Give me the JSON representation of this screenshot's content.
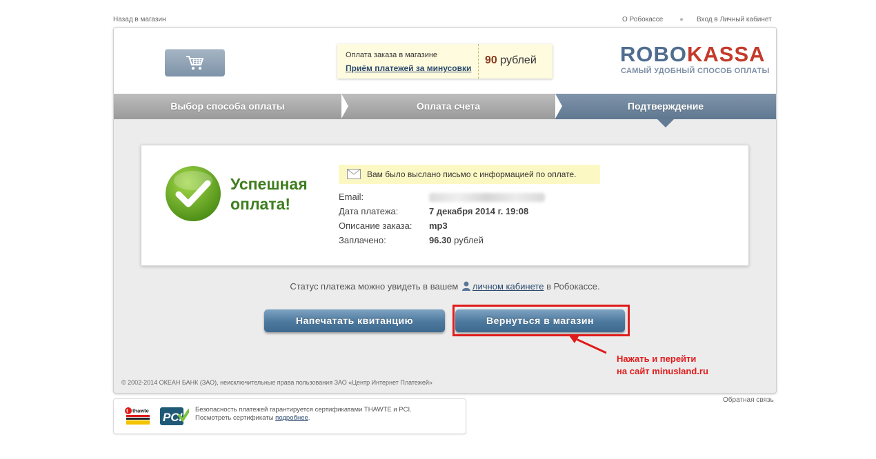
{
  "toplinks": {
    "back_to_shop": "Назад в магазин",
    "about": "О Робокассе",
    "login": "Вход в Личный кабинет"
  },
  "header": {
    "order_label": "Оплата заказа в магазине",
    "shop_name": "Приём платежей за минусовки",
    "amount_value": "90",
    "amount_unit": "рублей",
    "logo_part1": "ROBO",
    "logo_part2": "KASSA",
    "tagline": "САМЫЙ УДОБНЫЙ СПОСОБ ОПЛАТЫ"
  },
  "steps": [
    {
      "label": "Выбор способа оплаты",
      "active": false
    },
    {
      "label": "Оплата счета",
      "active": false
    },
    {
      "label": "Подтверждение",
      "active": true
    }
  ],
  "result": {
    "title_line1": "Успешная",
    "title_line2": "оплата!",
    "notice": "Вам было выслано письмо с информацией по оплате.",
    "fields": [
      {
        "key": "Email:",
        "value": ""
      },
      {
        "key": "Дата платежа:",
        "value": "7 декабря 2014 г. 19:08"
      },
      {
        "key": "Описание заказа:",
        "value": "mp3"
      },
      {
        "key": "Заплачено:",
        "value": "96.30",
        "unit": "рублей"
      }
    ]
  },
  "status": {
    "before": "Статус платежа можно увидеть в вашем",
    "link": "личном кабинете",
    "after": "в Робокассе."
  },
  "buttons": {
    "print": "Напечатать квитанцию",
    "back": "Вернуться в магазин"
  },
  "annotation": {
    "line1": "Нажать и перейти",
    "line2": "на сайт minusland.ru"
  },
  "copyright": "© 2002-2014 ОКЕАН БАНК (ЗАО), неисключительные права пользования ЗАО «Центр Интернет Платежей»",
  "feedback": "Обратная связь",
  "security": {
    "line1": "Безопасность платежей гарантируется сертификатами THAWTE и PCI.",
    "line2_before": "Посмотреть сертификаты",
    "line2_link": "подробнее",
    "thawte_logo": "thawte",
    "pci_logo": "PCI"
  },
  "colors": {
    "accent_red": "#e01b1b",
    "success_green": "#3e7d1e",
    "button_blue": "#4c789d",
    "brand_blue": "#4f6d8f",
    "brand_red": "#c43a2a"
  }
}
